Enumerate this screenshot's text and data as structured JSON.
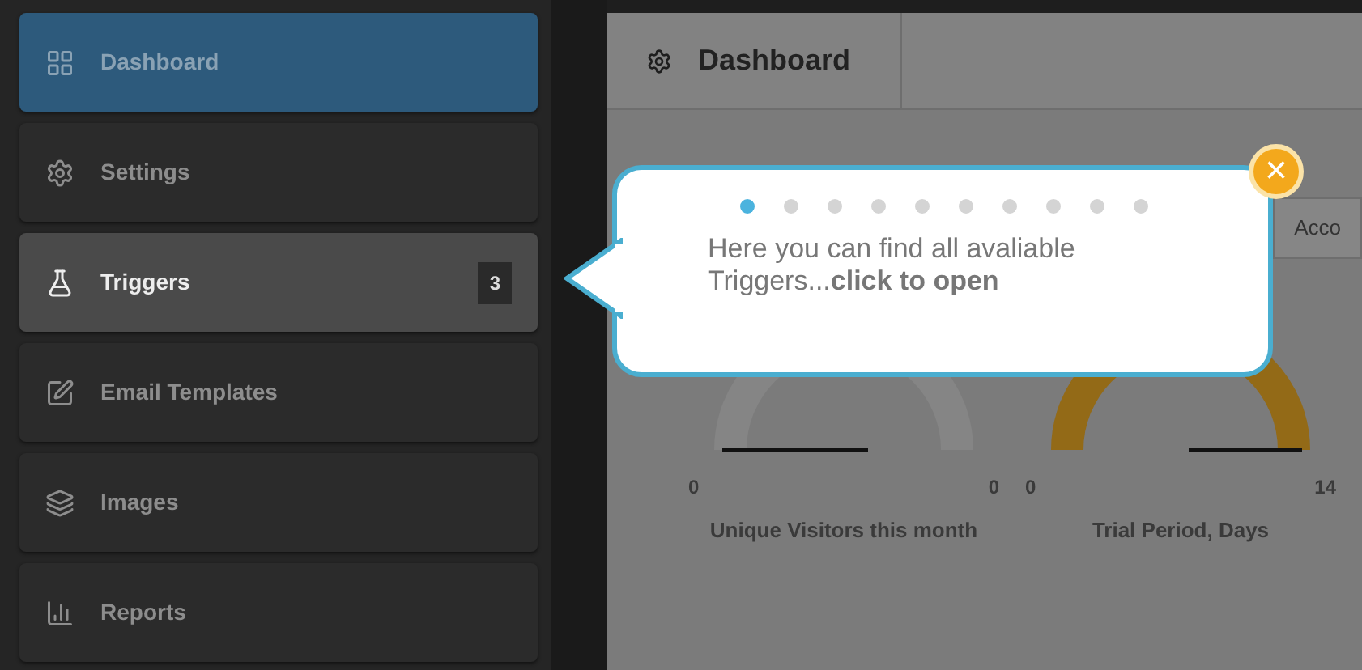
{
  "sidebar": {
    "items": [
      {
        "label": "Dashboard",
        "selected": true,
        "highlighted": false
      },
      {
        "label": "Settings",
        "selected": false,
        "highlighted": false
      },
      {
        "label": "Triggers",
        "selected": false,
        "highlighted": true,
        "badge": "3"
      },
      {
        "label": "Email Templates",
        "selected": false,
        "highlighted": false
      },
      {
        "label": "Images",
        "selected": false,
        "highlighted": false
      },
      {
        "label": "Reports",
        "selected": false,
        "highlighted": false
      }
    ]
  },
  "main": {
    "header": {
      "title": "Dashboard"
    },
    "tab_peek": "Acco",
    "gauges": [
      {
        "min": "0",
        "max": "0",
        "label": "Unique Visitors this month",
        "color": "#858585"
      },
      {
        "min": "0",
        "max": "14",
        "label": "Trial Period, Days",
        "color": "#936a17"
      }
    ]
  },
  "tour_tooltip": {
    "steps": [
      {
        "selected": true
      },
      {
        "selected": false
      },
      {
        "selected": false
      },
      {
        "selected": false
      },
      {
        "selected": false
      },
      {
        "selected": false
      },
      {
        "selected": false
      },
      {
        "selected": false
      },
      {
        "selected": false
      },
      {
        "selected": false
      }
    ],
    "message": "Here you can find all avaliable Triggers...**click to open**",
    "close_symbol": "×"
  }
}
